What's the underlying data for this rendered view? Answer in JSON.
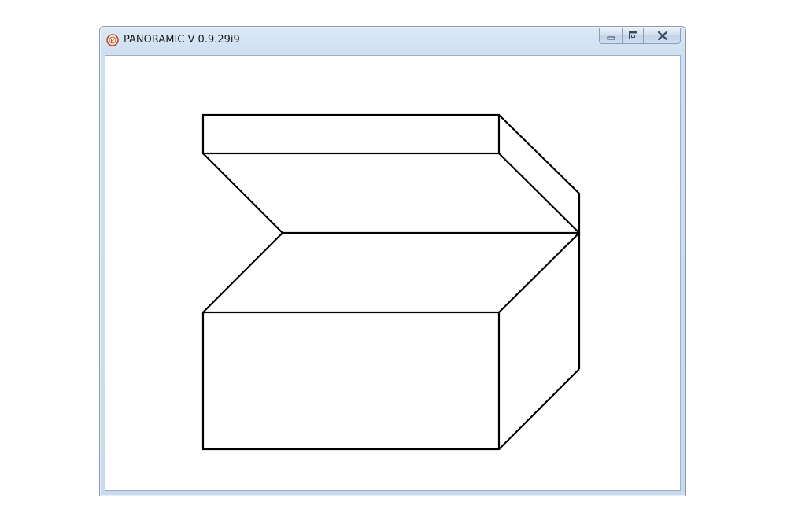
{
  "window": {
    "title": "PANORAMIC V 0.9.29i9"
  },
  "icons": {
    "app": "panoramic-app-icon",
    "minimize": "minimize-icon",
    "maximize": "maximize-icon",
    "close": "close-icon"
  },
  "colors": {
    "line": "#000000",
    "canvas": "#ffffff"
  }
}
